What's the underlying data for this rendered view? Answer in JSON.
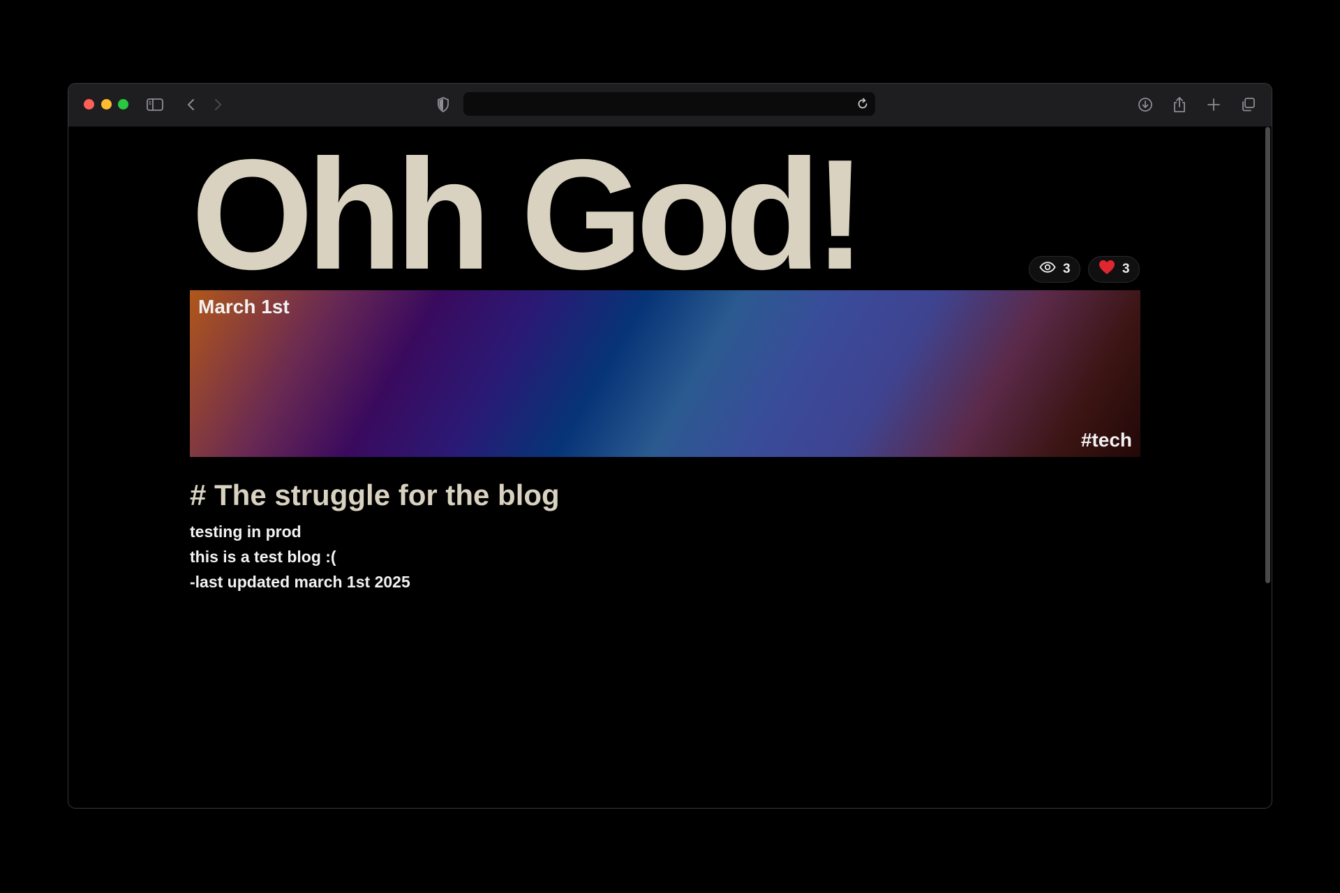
{
  "browser": {
    "toolbar_icons": [
      "sidebar-icon",
      "back-icon",
      "forward-icon",
      "privacy-shield-icon",
      "reload-icon",
      "download-icon",
      "share-icon",
      "new-tab-icon",
      "tab-overview-icon"
    ],
    "address_value": ""
  },
  "page": {
    "title": "Ohh God!",
    "stats": {
      "views": "3",
      "likes": "3"
    },
    "banner": {
      "date": "March 1st",
      "tag": "#tech"
    },
    "post": {
      "heading": "# The struggle for the blog",
      "lines": [
        "testing in prod",
        "this is a test blog :(",
        "-last updated march 1st 2025"
      ]
    }
  },
  "colors": {
    "title": "#d9d2c1",
    "text": "#f2f2f2",
    "heart": "#e0262f"
  }
}
